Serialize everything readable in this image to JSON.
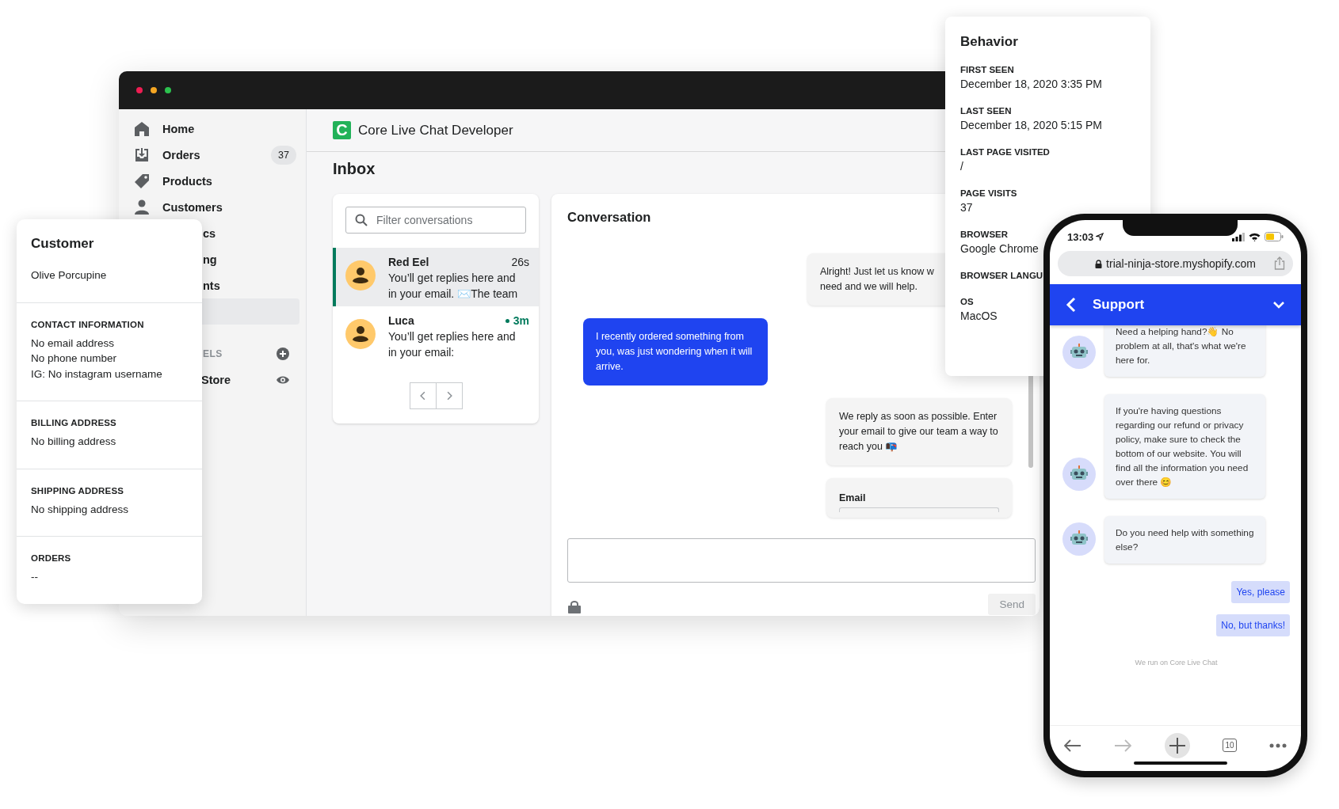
{
  "sidebar": {
    "items": [
      {
        "kind": "full",
        "label": "Home",
        "selected": false
      },
      {
        "kind": "full",
        "label": "Orders",
        "badge": "37",
        "selected": false
      },
      {
        "kind": "full",
        "label": "Products",
        "selected": false
      },
      {
        "kind": "full",
        "label": "Customers",
        "selected": false
      },
      {
        "kind": "clipped",
        "label": "cs",
        "selected": false
      },
      {
        "kind": "clipped",
        "label": "ng",
        "selected": false
      },
      {
        "kind": "clipped",
        "label": "nts",
        "selected": false
      },
      {
        "kind": "clipped",
        "selected": true
      }
    ],
    "section": "ELS",
    "channels": [
      {
        "label": "Store"
      }
    ]
  },
  "app": {
    "logo": "C",
    "title": "Core Live Chat Developer",
    "page_title": "Inbox"
  },
  "conversations": {
    "search": {
      "placeholder": "Filter conversations"
    },
    "items": [
      {
        "name": "Red Eel",
        "time": "26s",
        "online": false,
        "preview": "You’ll get replies here and in your email. ✉️The team",
        "selected": true
      },
      {
        "name": "Luca",
        "time": "3m",
        "online": true,
        "preview": "You’ll get replies here and in your email:",
        "selected": false
      }
    ]
  },
  "conversation": {
    "title": "Conversation",
    "messages": [
      {
        "kind": "agent",
        "text": "Alright! Just let us know w\nneed and we will help."
      },
      {
        "kind": "customer",
        "text": "I recently ordered something from you, was just wondering when it will arrive."
      },
      {
        "kind": "agent",
        "text": "We reply as soon as possible. Enter your email to give our team a way to reach you 📭"
      },
      {
        "kind": "form",
        "text": "Email"
      }
    ],
    "send": "Send"
  },
  "customer_card": {
    "title": "Customer",
    "name": "Olive Porcupine",
    "sections": [
      {
        "heading": "CONTACT INFORMATION",
        "lines": [
          "No email address",
          "No phone number",
          "IG: No instagram username"
        ]
      },
      {
        "heading": "BILLING ADDRESS",
        "lines": [
          "No billing address"
        ]
      },
      {
        "heading": "SHIPPING ADDRESS",
        "lines": [
          "No shipping address"
        ]
      },
      {
        "heading": "ORDERS",
        "lines": [
          "--"
        ]
      }
    ]
  },
  "behavior": {
    "title": "Behavior",
    "fields": [
      {
        "label": "FIRST SEEN",
        "value": "December 18, 2020 3:35 PM"
      },
      {
        "label": "LAST SEEN",
        "value": "December 18, 2020 5:15 PM"
      },
      {
        "label": "LAST PAGE VISITED",
        "value": "/"
      },
      {
        "label": "PAGE VISITS",
        "value": "37"
      },
      {
        "label": "BROWSER",
        "value": "Google Chrome"
      },
      {
        "label": "BROWSER LANGU"
      },
      {
        "label": "OS",
        "value": "MacOS"
      }
    ]
  },
  "phone": {
    "time": "13:03",
    "url": "trial-ninja-store.myshopify.com",
    "chat_title": "Support",
    "messages": [
      {
        "text": "Need a helping hand?👋 No problem at all, that's what we're here for."
      },
      {
        "text": "If you're having questions regarding our refund or privacy policy, make sure to check the bottom of our website. You will find all the information you need over there 😊"
      },
      {
        "text": "Do you need help with something else?"
      }
    ],
    "quick_replies": [
      "Yes, please",
      "No, but thanks!"
    ],
    "footer": "We run on Core Live Chat",
    "tab_count": "10"
  }
}
